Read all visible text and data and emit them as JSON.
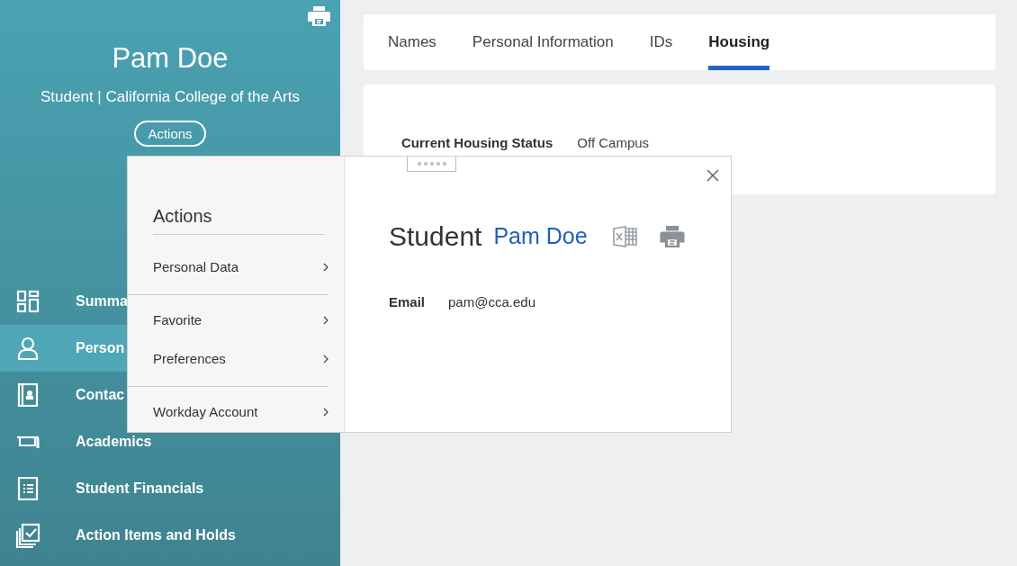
{
  "profile": {
    "name": "Pam Doe",
    "subtitle": "Student | California College of the Arts",
    "actions_button": "Actions"
  },
  "nav": [
    {
      "label": "Summa",
      "kind": "grid",
      "selected": false
    },
    {
      "label": "Person",
      "kind": "person",
      "selected": true
    },
    {
      "label": "Contac",
      "kind": "contact",
      "selected": false
    },
    {
      "label": "Academics",
      "kind": "cap",
      "selected": false
    },
    {
      "label": "Student Financials",
      "kind": "list",
      "selected": false
    },
    {
      "label": "Action Items and Holds",
      "kind": "check",
      "selected": false
    }
  ],
  "tabs": [
    {
      "label": "Names",
      "selected": false
    },
    {
      "label": "Personal Information",
      "selected": false
    },
    {
      "label": "IDs",
      "selected": false
    },
    {
      "label": "Housing",
      "selected": true
    }
  ],
  "housing": {
    "label": "Current Housing Status",
    "value": "Off Campus"
  },
  "actions_menu": {
    "title": "Actions",
    "groups": [
      [
        "Personal Data"
      ],
      [
        "Favorite",
        "Preferences"
      ],
      [
        "Workday Account"
      ]
    ]
  },
  "popup": {
    "kind_label": "Student",
    "name": "Pam Doe",
    "fields": [
      {
        "label": "Email",
        "value": "pam@cca.edu"
      }
    ]
  }
}
